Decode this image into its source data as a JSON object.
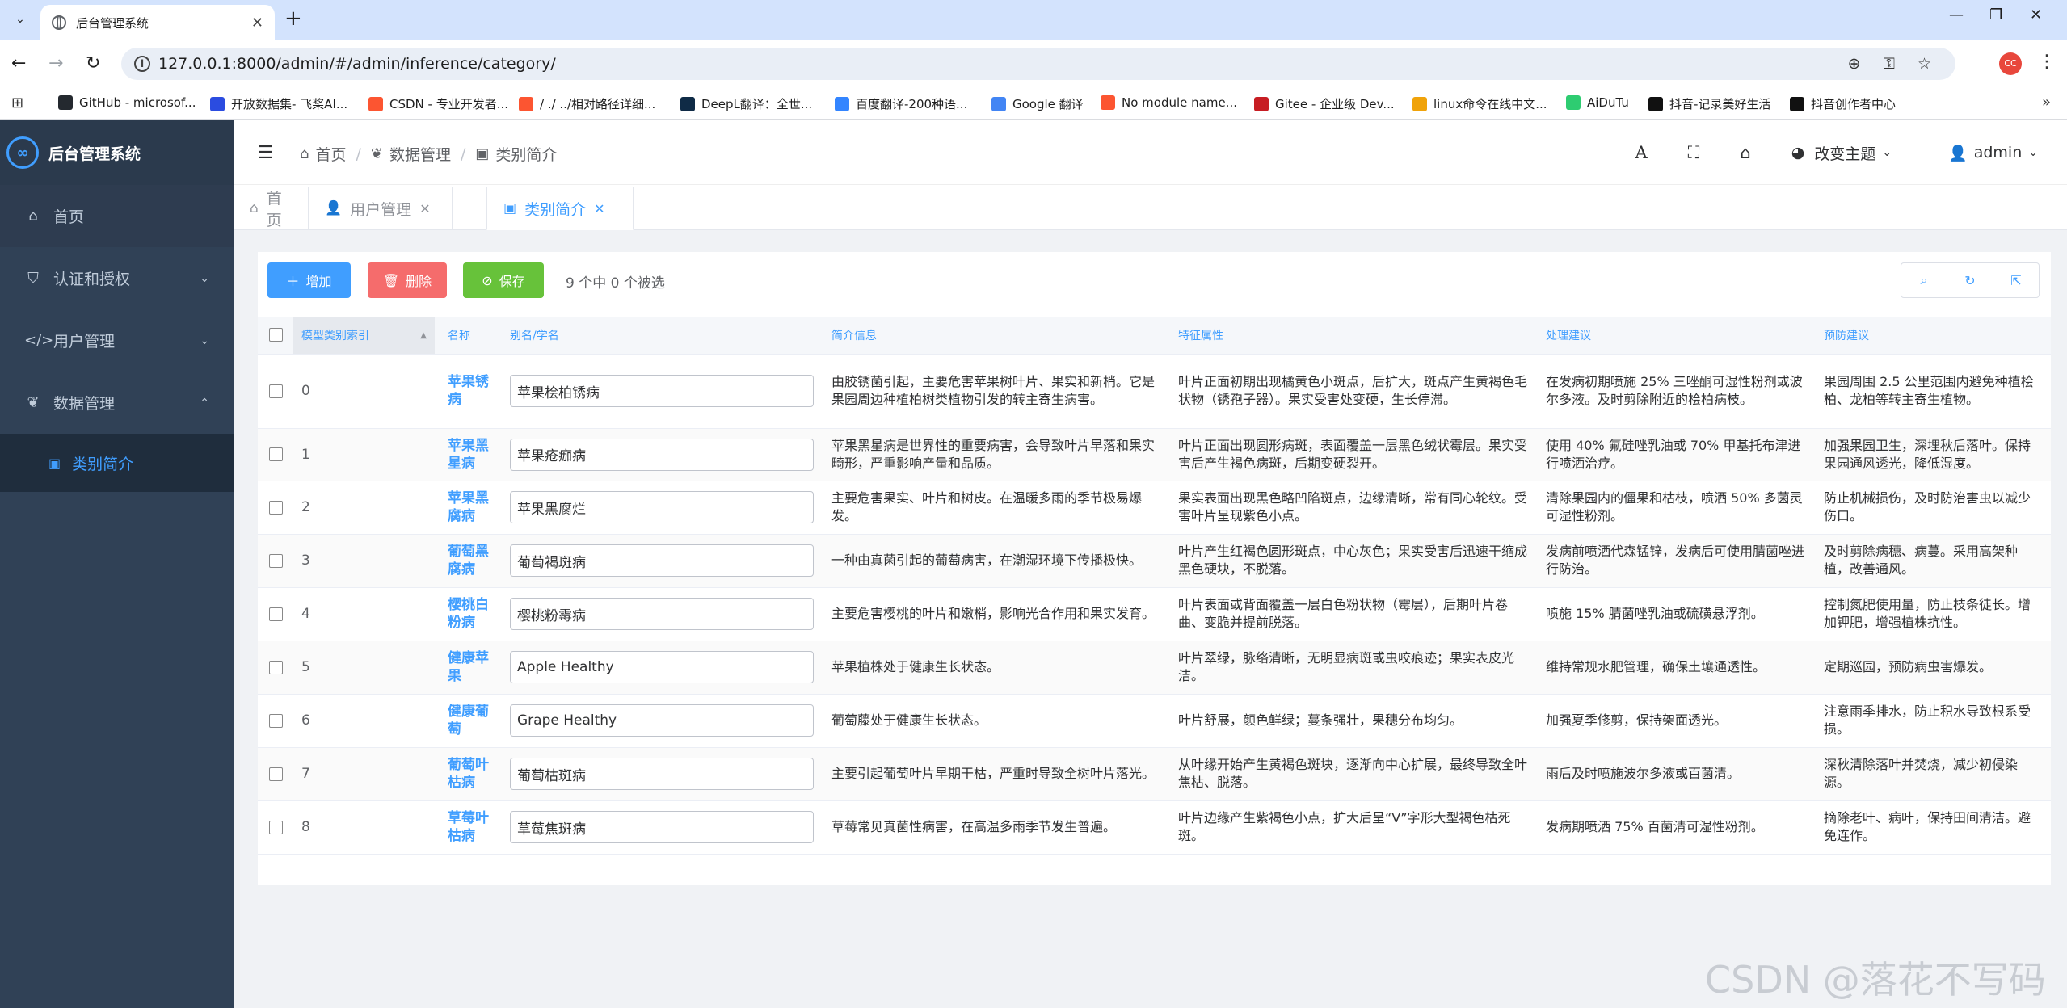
{
  "browser": {
    "tab_title": "后台管理系统",
    "tab_close": "✕",
    "new_tab": "+",
    "url": "127.0.0.1:8000/admin/#/admin/inference/category/",
    "profile_initials": "CC",
    "bookmarks": [
      {
        "label": "GitHub - microsof...",
        "color": "#24292f"
      },
      {
        "label": "开放数据集- 飞桨AI...",
        "color": "#2b4ce0"
      },
      {
        "label": "CSDN - 专业开发者...",
        "color": "#fc5531"
      },
      {
        "label": "/ ./ ../相对路径详细...",
        "color": "#fc5531"
      },
      {
        "label": "DeepL翻译：全世...",
        "color": "#0f2b46"
      },
      {
        "label": "百度翻译-200种语...",
        "color": "#3385ff"
      },
      {
        "label": "Google 翻译",
        "color": "#4285f4"
      },
      {
        "label": "No module name...",
        "color": "#fc5531"
      },
      {
        "label": "Gitee - 企业级 Dev...",
        "color": "#c71d23"
      },
      {
        "label": "linux命令在线中文...",
        "color": "#f0a30a"
      },
      {
        "label": "AiDuTu",
        "color": "#2ecc71"
      },
      {
        "label": "抖音-记录美好生活",
        "color": "#111111"
      },
      {
        "label": "抖音创作者中心",
        "color": "#111111"
      }
    ]
  },
  "sidebar": {
    "logo_text": "后台管理系统",
    "items": [
      {
        "label": "首页"
      },
      {
        "label": "认证和授权"
      },
      {
        "label": "用户管理"
      },
      {
        "label": "数据管理"
      }
    ],
    "subitem": "类别简介"
  },
  "header": {
    "breadcrumb": [
      "首页",
      "数据管理",
      "类别简介"
    ],
    "theme_label": "改变主题",
    "user": "admin"
  },
  "tags": [
    {
      "label": "首页"
    },
    {
      "label": "用户管理"
    },
    {
      "label": "类别简介"
    }
  ],
  "actions": {
    "add": "增加",
    "delete": "删除",
    "save": "保存",
    "selection": "9 个中 0 个被选"
  },
  "table": {
    "headers": [
      "模型类别索引",
      "名称",
      "别名/学名",
      "简介信息",
      "特征属性",
      "处理建议",
      "预防建议"
    ],
    "rows": [
      {
        "idx": "0",
        "name": "苹果锈病",
        "alias": "苹果桧柏锈病",
        "intro": "由胶锈菌引起，主要危害苹果树叶片、果实和新梢。它是果园周边种植柏树类植物引发的转主寄生病害。",
        "feature": "叶片正面初期出现橘黄色小斑点，后扩大，斑点产生黄褐色毛状物（锈孢子器）。果实受害处变硬，生长停滞。",
        "treat": "在发病初期喷施 25% 三唑酮可湿性粉剂或波尔多液。及时剪除附近的桧柏病枝。",
        "prevent": "果园周围 2.5 公里范围内避免种植桧柏、龙柏等转主寄生植物。"
      },
      {
        "idx": "1",
        "name": "苹果黑星病",
        "alias": "苹果疮痂病",
        "intro": "苹果黑星病是世界性的重要病害，会导致叶片早落和果实畸形，严重影响产量和品质。",
        "feature": "叶片正面出现圆形病斑，表面覆盖一层黑色绒状霉层。果实受害后产生褐色病斑，后期变硬裂开。",
        "treat": "使用 40% 氟硅唑乳油或 70% 甲基托布津进行喷洒治疗。",
        "prevent": "加强果园卫生，深埋秋后落叶。保持果园通风透光，降低湿度。"
      },
      {
        "idx": "2",
        "name": "苹果黑腐病",
        "alias": "苹果黑腐烂",
        "intro": "主要危害果实、叶片和树皮。在温暖多雨的季节极易爆发。",
        "feature": "果实表面出现黑色略凹陷斑点，边缘清晰，常有同心轮纹。受害叶片呈现紫色小点。",
        "treat": "清除果园内的僵果和枯枝，喷洒 50% 多菌灵可湿性粉剂。",
        "prevent": "防止机械损伤，及时防治害虫以减少伤口。"
      },
      {
        "idx": "3",
        "name": "葡萄黑腐病",
        "alias": "葡萄褐斑病",
        "intro": "一种由真菌引起的葡萄病害，在潮湿环境下传播极快。",
        "feature": "叶片产生红褐色圆形斑点，中心灰色；果实受害后迅速干缩成黑色硬块，不脱落。",
        "treat": "发病前喷洒代森锰锌，发病后可使用腈菌唑进行防治。",
        "prevent": "及时剪除病穗、病蔓。采用高架种植，改善通风。"
      },
      {
        "idx": "4",
        "name": "樱桃白粉病",
        "alias": "樱桃粉霉病",
        "intro": "主要危害樱桃的叶片和嫩梢，影响光合作用和果实发育。",
        "feature": "叶片表面或背面覆盖一层白色粉状物（霉层），后期叶片卷曲、变脆并提前脱落。",
        "treat": "喷施 15% 腈菌唑乳油或硫磺悬浮剂。",
        "prevent": "控制氮肥使用量，防止枝条徒长。增加钾肥，增强植株抗性。"
      },
      {
        "idx": "5",
        "name": "健康苹果",
        "alias": "Apple Healthy",
        "intro": "苹果植株处于健康生长状态。",
        "feature": "叶片翠绿，脉络清晰，无明显病斑或虫咬痕迹；果实表皮光洁。",
        "treat": "维持常规水肥管理，确保土壤通透性。",
        "prevent": "定期巡园，预防病虫害爆发。"
      },
      {
        "idx": "6",
        "name": "健康葡萄",
        "alias": "Grape Healthy",
        "intro": "葡萄藤处于健康生长状态。",
        "feature": "叶片舒展，颜色鲜绿；蔓条强壮，果穗分布均匀。",
        "treat": "加强夏季修剪，保持架面透光。",
        "prevent": "注意雨季排水，防止积水导致根系受损。"
      },
      {
        "idx": "7",
        "name": "葡萄叶枯病",
        "alias": "葡萄枯斑病",
        "intro": "主要引起葡萄叶片早期干枯，严重时导致全树叶片落光。",
        "feature": "从叶缘开始产生黄褐色斑块，逐渐向中心扩展，最终导致全叶焦枯、脱落。",
        "treat": "雨后及时喷施波尔多液或百菌清。",
        "prevent": "深秋清除落叶并焚烧，减少初侵染源。"
      },
      {
        "idx": "8",
        "name": "草莓叶枯病",
        "alias": "草莓焦斑病",
        "intro": "草莓常见真菌性病害，在高温多雨季节发生普遍。",
        "feature": "叶片边缘产生紫褐色小点，扩大后呈“V”字形大型褐色枯死斑。",
        "treat": "发病期喷洒 75% 百菌清可湿性粉剂。",
        "prevent": "摘除老叶、病叶，保持田间清洁。避免连作。"
      }
    ]
  },
  "watermark": "CSDN @落花不写码"
}
